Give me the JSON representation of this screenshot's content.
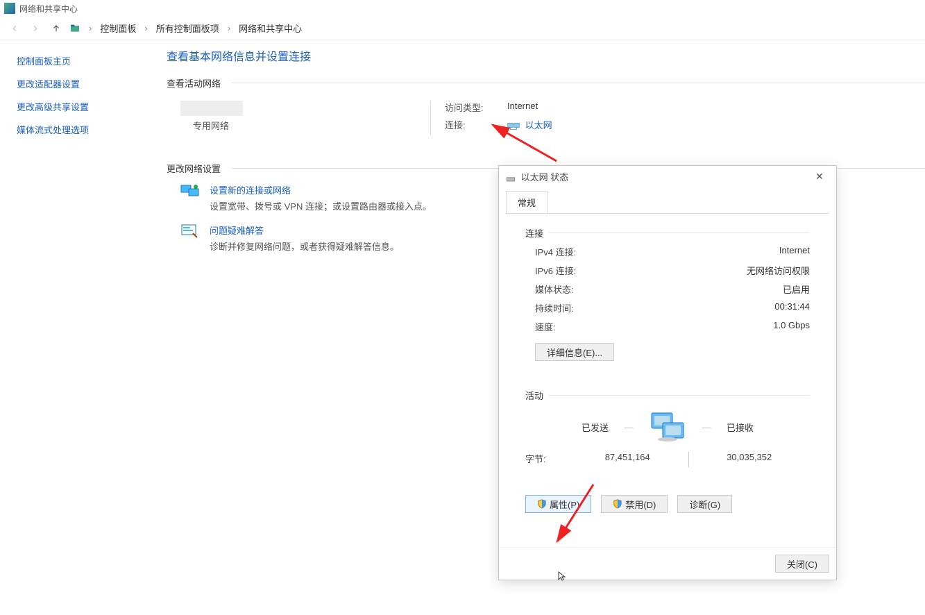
{
  "window_title": "网络和共享中心",
  "breadcrumb": {
    "l1": "控制面板",
    "l2": "所有控制面板项",
    "l3": "网络和共享中心"
  },
  "sidebar": {
    "home": "控制面板主页",
    "adapter": "更改适配器设置",
    "advanced_sharing": "更改高级共享设置",
    "media_streaming": "媒体流式处理选项"
  },
  "content": {
    "heading": "查看基本网络信息并设置连接",
    "active_networks_label": "查看活动网络",
    "network_type": "专用网络",
    "access_type_label": "访问类型:",
    "access_type_value": "Internet",
    "connection_label": "连接:",
    "connection_value": "以太网",
    "change_settings_label": "更改网络设置",
    "opt1_title": "设置新的连接或网络",
    "opt1_desc": "设置宽带、拨号或 VPN 连接；或设置路由器或接入点。",
    "opt2_title": "问题疑难解答",
    "opt2_desc": "诊断并修复网络问题，或者获得疑难解答信息。"
  },
  "dialog": {
    "title": "以太网 状态",
    "tab": "常规",
    "group_connection": "连接",
    "ipv4_label": "IPv4 连接:",
    "ipv4_value": "Internet",
    "ipv6_label": "IPv6 连接:",
    "ipv6_value": "无网络访问权限",
    "media_label": "媒体状态:",
    "media_value": "已启用",
    "duration_label": "持续时间:",
    "duration_value": "00:31:44",
    "speed_label": "速度:",
    "speed_value": "1.0 Gbps",
    "details_btn": "详细信息(E)...",
    "group_activity": "活动",
    "sent_label": "已发送",
    "recv_label": "已接收",
    "bytes_label": "字节:",
    "bytes_sent": "87,451,164",
    "bytes_recv": "30,035,352",
    "properties_btn": "属性(P)",
    "disable_btn": "禁用(D)",
    "diagnose_btn": "诊断(G)",
    "close_btn": "关闭(C)"
  }
}
